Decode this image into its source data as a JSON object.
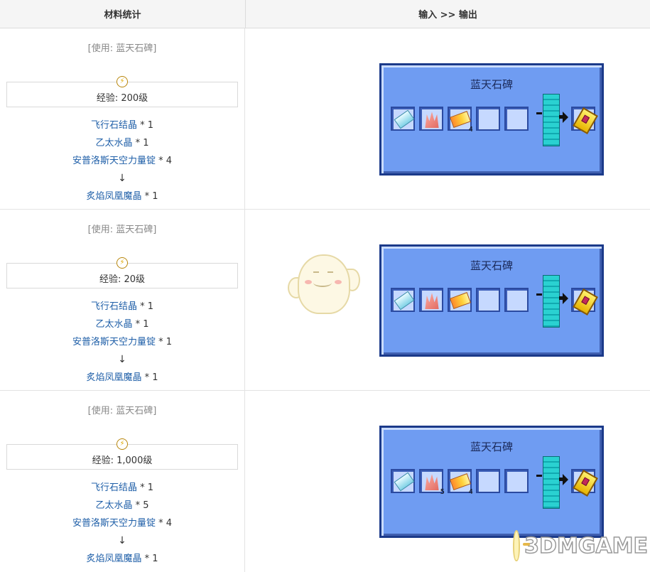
{
  "header": {
    "col1": "材料统计",
    "col2": "输入 >> 输出"
  },
  "recipes": [
    {
      "use": "[使用: 蓝天石碑]",
      "exp": "经验: 200级",
      "materials": [
        {
          "name": "飞行石结晶",
          "qty": " * 1"
        },
        {
          "name": "乙太水晶",
          "qty": " * 1"
        },
        {
          "name": "安普洛斯天空力量锭",
          "qty": " * 4"
        }
      ],
      "arrow": "↓",
      "output": {
        "name": "炙焰凤凰魔晶",
        "qty": " * 1"
      },
      "gui_title": "蓝天石碑",
      "slot_counts": [
        "",
        "",
        "4"
      ]
    },
    {
      "use": "[使用: 蓝天石碑]",
      "exp": "经验: 20级",
      "materials": [
        {
          "name": "飞行石结晶",
          "qty": " * 1"
        },
        {
          "name": "乙太水晶",
          "qty": " * 1"
        },
        {
          "name": "安普洛斯天空力量锭",
          "qty": " * 1"
        }
      ],
      "arrow": "↓",
      "output": {
        "name": "炙焰凤凰魔晶",
        "qty": " * 1"
      },
      "gui_title": "蓝天石碑",
      "slot_counts": [
        "",
        "",
        ""
      ]
    },
    {
      "use": "[使用: 蓝天石碑]",
      "exp": "经验: 1,000级",
      "materials": [
        {
          "name": "飞行石结晶",
          "qty": " * 1"
        },
        {
          "name": "乙太水晶",
          "qty": " * 5"
        },
        {
          "name": "安普洛斯天空力量锭",
          "qty": " * 4"
        }
      ],
      "arrow": "↓",
      "output": {
        "name": "炙焰凤凰魔晶",
        "qty": " * 1"
      },
      "gui_title": "蓝天石碑",
      "slot_counts": [
        "",
        "5",
        "4"
      ]
    }
  ],
  "icons": {
    "exp": "lightning-icon",
    "slot1": "flight-stone-crystal-icon",
    "slot2": "aether-crystal-icon",
    "slot3": "ambrosium-ingot-icon",
    "output": "phoenix-gem-icon"
  },
  "watermark": "3DMGAME",
  "colors": {
    "link": "#1f5fa8",
    "gui_bg": "#6f9cf2",
    "gui_border": "#1b3a8a",
    "slot_bg": "#c6d9ff"
  }
}
